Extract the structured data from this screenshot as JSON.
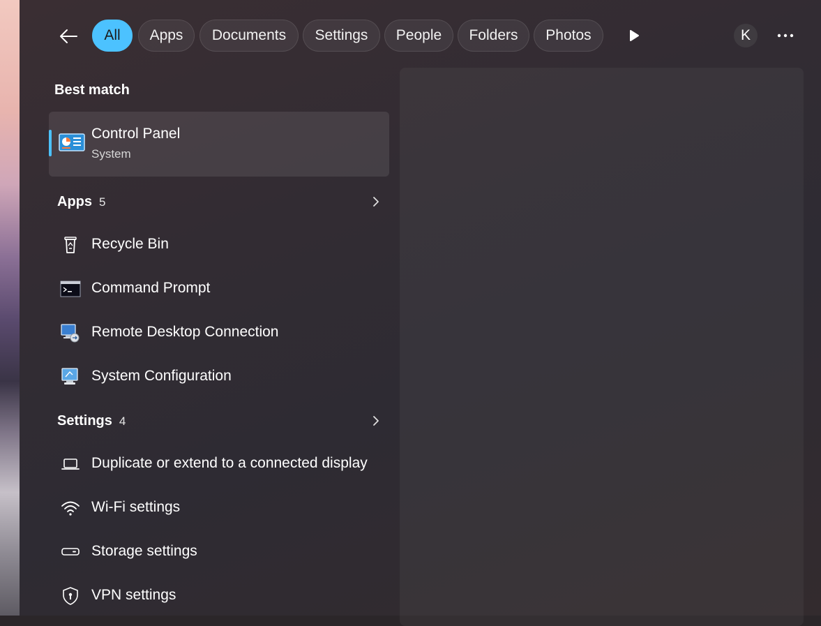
{
  "filters": [
    {
      "label": "All",
      "active": true
    },
    {
      "label": "Apps",
      "active": false
    },
    {
      "label": "Documents",
      "active": false
    },
    {
      "label": "Settings",
      "active": false
    },
    {
      "label": "People",
      "active": false
    },
    {
      "label": "Folders",
      "active": false
    },
    {
      "label": "Photos",
      "active": false
    }
  ],
  "user": {
    "initial": "K"
  },
  "best_match": {
    "heading": "Best match",
    "title": "Control Panel",
    "subtitle": "System"
  },
  "apps": {
    "heading": "Apps",
    "count": "5",
    "items": [
      {
        "label": "Recycle Bin"
      },
      {
        "label": "Command Prompt"
      },
      {
        "label": "Remote Desktop Connection"
      },
      {
        "label": "System Configuration"
      }
    ]
  },
  "settings": {
    "heading": "Settings",
    "count": "4",
    "items": [
      {
        "label": "Duplicate or extend to a connected display"
      },
      {
        "label": "Wi-Fi settings"
      },
      {
        "label": "Storage settings"
      },
      {
        "label": "VPN settings"
      }
    ]
  },
  "colors": {
    "accent": "#4cc2ff"
  }
}
